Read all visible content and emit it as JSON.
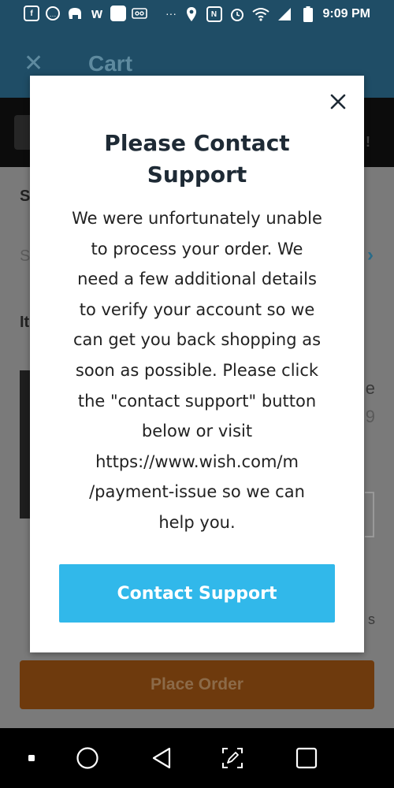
{
  "status_bar": {
    "time": "9:09 PM",
    "notification_icons": [
      "facebook-icon",
      "phone-chat-icon",
      "elephant-icon",
      "wish-icon",
      "app-icon",
      "voicemail-icon"
    ],
    "more": "···",
    "system_icons": [
      "location-icon",
      "nfc-icon",
      "alarm-icon",
      "wifi-icon",
      "signal-icon",
      "battery-icon"
    ]
  },
  "app_bar": {
    "title": "Cart"
  },
  "background": {
    "section_label_1": "S",
    "field_placeholder": "S",
    "section_label_2": "It",
    "item_text_1": "e",
    "item_text_2": "9",
    "item_text_3": "s",
    "place_order_label": "Place Order"
  },
  "modal": {
    "title": "Please Contact Support",
    "body_lines": [
      "We were unfortunately unable",
      "to process your order. We",
      "need a few additional details",
      "to verify your account so we",
      "can get you back shopping as",
      "soon as possible. Please click",
      "the \"contact support\" button",
      "below or visit",
      "https://www.wish.com/m",
      "/payment-issue so we can",
      "help you."
    ],
    "button_label": "Contact Support"
  },
  "colors": {
    "accent": "#31b8ea",
    "app_bar": "#1f4d66",
    "place_order": "#6e3a0d"
  }
}
